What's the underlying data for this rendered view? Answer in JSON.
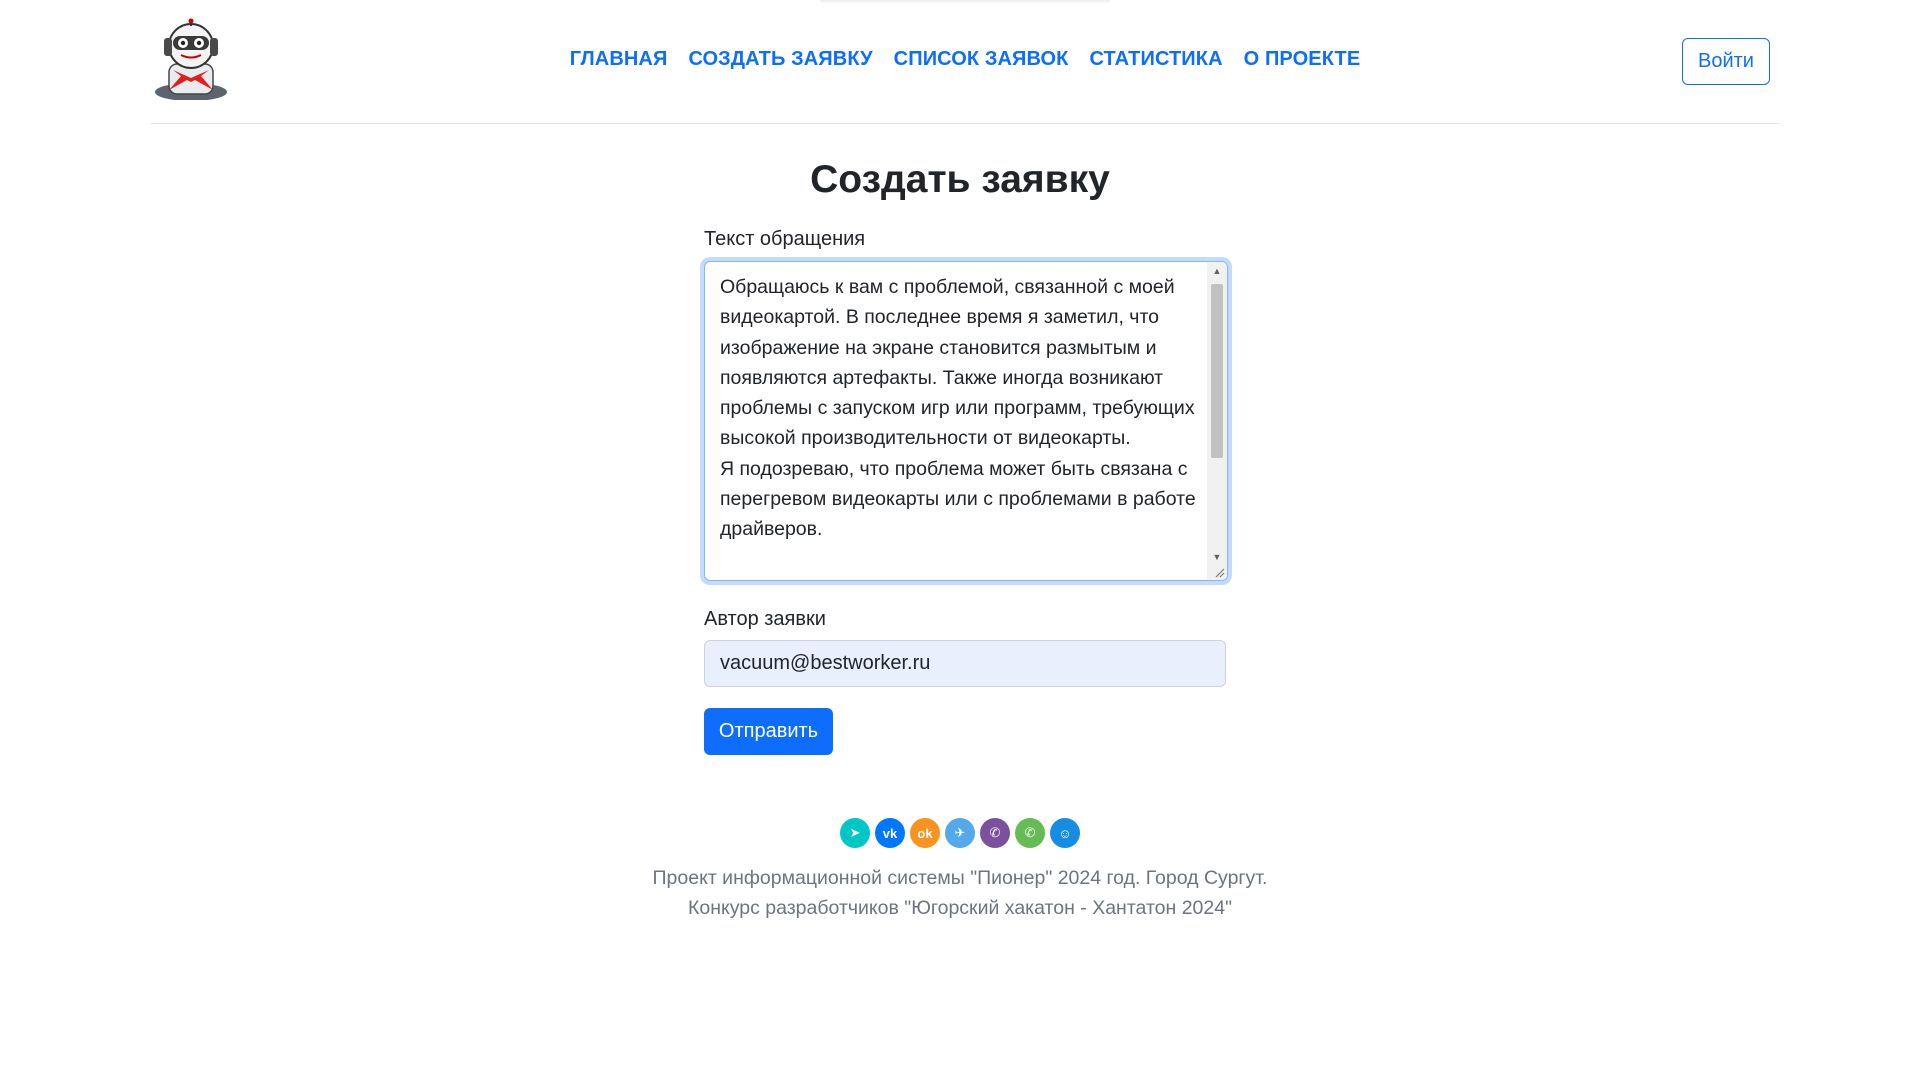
{
  "nav": {
    "items": [
      "ГЛАВНАЯ",
      "СОЗДАТЬ ЗАЯВКУ",
      "СПИСОК ЗАЯВОК",
      "СТАТИСТИКА",
      "О ПРОЕКТЕ"
    ],
    "login_label": "Войти"
  },
  "form": {
    "title": "Создать заявку",
    "text_label": "Текст обращения",
    "text_value": "Обращаюсь к вам с проблемой, связанной с моей видеокартой. В последнее время я заметил, что изображение на экране становится размытым и появляются артефакты. Также иногда возникают проблемы с запуском игр или программ, требующих высокой производительности от видеокарты.\nЯ подозреваю, что проблема может быть связана с перегревом видеокарты или с проблемами в работе драйверов.",
    "author_label": "Автор заявки",
    "author_value": "vacuum@bestworker.ru",
    "submit_label": "Отправить"
  },
  "social": [
    {
      "name": "share-icon",
      "glyph": "➤",
      "color": "#00c6c6"
    },
    {
      "name": "vk-icon",
      "glyph": "vk",
      "color": "#0077ff"
    },
    {
      "name": "odnoklassniki-icon",
      "glyph": "ok",
      "color": "#f7931e"
    },
    {
      "name": "telegram-icon",
      "glyph": "✈",
      "color": "#54a9eb"
    },
    {
      "name": "viber-icon",
      "glyph": "✆",
      "color": "#7b519d"
    },
    {
      "name": "whatsapp-icon",
      "glyph": "✆",
      "color": "#65bc54"
    },
    {
      "name": "moimir-icon",
      "glyph": "☺",
      "color": "#168de2"
    }
  ],
  "footer": {
    "line1": "Проект информационной системы \"Пионер\" 2024 год. Город Сургут.",
    "line2": "Конкурс разработчиков \"Югорский хакатон - Хантатон 2024\""
  }
}
